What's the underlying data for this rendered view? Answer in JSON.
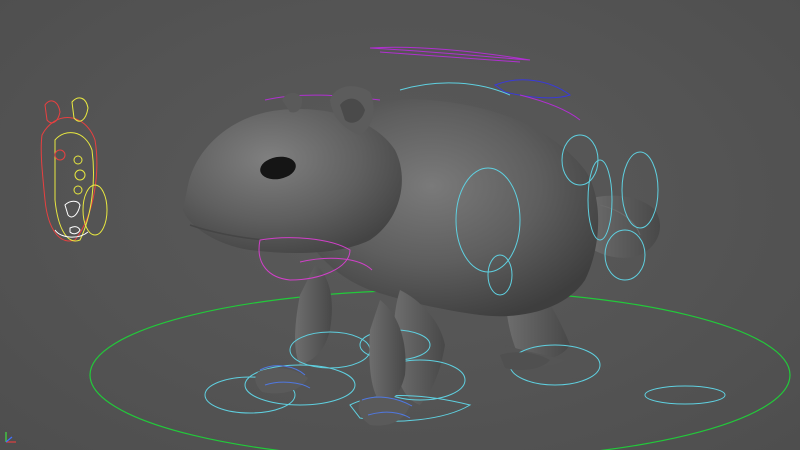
{
  "viewport": {
    "mode": "perspective",
    "background_color": "#545454",
    "model_color": "#5f5f5f",
    "controls": {
      "ground_ring_color": "#22c93a",
      "limb_control_color": "#5fd0e0",
      "spine_control_color": "#b030d0",
      "head_control_color": "#d040c8",
      "ear_control_color": "#3a3ad8",
      "face_picker_left_color": "#e84040",
      "face_picker_right_color": "#e8e840",
      "face_picker_detail_color": "#ffffff"
    },
    "axis_gizmo": {
      "x_color": "#e04040",
      "y_color": "#40e040",
      "z_color": "#4070ff"
    }
  }
}
